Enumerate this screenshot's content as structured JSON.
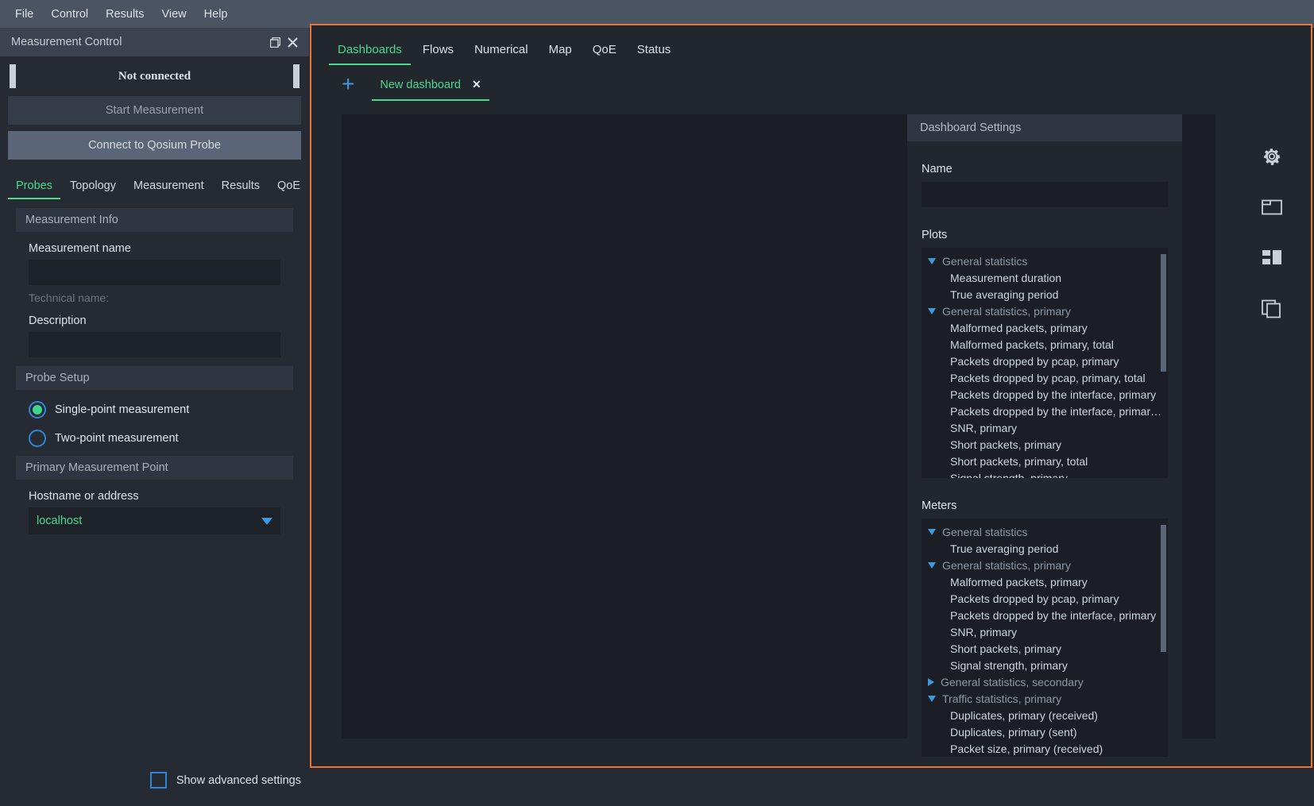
{
  "menubar": {
    "items": [
      "File",
      "Control",
      "Results",
      "View",
      "Help"
    ]
  },
  "left_panel": {
    "title": "Measurement Control",
    "status": "Not connected",
    "start_button": "Start Measurement",
    "connect_button": "Connect to Qosium Probe",
    "tabs": [
      {
        "label": "Probes",
        "active": true
      },
      {
        "label": "Topology",
        "active": false
      },
      {
        "label": "Measurement",
        "active": false
      },
      {
        "label": "Results",
        "active": false
      },
      {
        "label": "QoE",
        "active": false
      }
    ],
    "measurement_info": {
      "header": "Measurement Info",
      "name_label": "Measurement name",
      "name_value": "",
      "technical_name": "Technical name:",
      "description_label": "Description",
      "description_value": ""
    },
    "probe_setup": {
      "header": "Probe Setup",
      "options": [
        {
          "label": "Single-point measurement",
          "selected": true
        },
        {
          "label": "Two-point measurement",
          "selected": false
        }
      ]
    },
    "primary_measurement_point": {
      "header": "Primary Measurement Point",
      "hostname_label": "Hostname or address",
      "hostname_value": "localhost"
    },
    "advanced": {
      "label": "Show advanced settings",
      "checked": false
    }
  },
  "main": {
    "tabs": [
      {
        "label": "Dashboards",
        "active": true
      },
      {
        "label": "Flows",
        "active": false
      },
      {
        "label": "Numerical",
        "active": false
      },
      {
        "label": "Map",
        "active": false
      },
      {
        "label": "QoE",
        "active": false
      },
      {
        "label": "Status",
        "active": false
      }
    ],
    "add_tab_glyph": "+",
    "dashboard_tabs": [
      {
        "label": "New dashboard",
        "close": "✕",
        "active": true
      }
    ]
  },
  "dashboard_settings": {
    "header": "Dashboard Settings",
    "name_label": "Name",
    "name_value": "",
    "plots_label": "Plots",
    "plots_tree": [
      {
        "type": "group",
        "label": "General statistics",
        "expanded": true
      },
      {
        "type": "leaf",
        "label": "Measurement duration"
      },
      {
        "type": "leaf",
        "label": "True averaging period"
      },
      {
        "type": "group",
        "label": "General statistics, primary",
        "expanded": true
      },
      {
        "type": "leaf",
        "label": "Malformed packets, primary"
      },
      {
        "type": "leaf",
        "label": "Malformed packets, primary, total"
      },
      {
        "type": "leaf",
        "label": "Packets dropped by pcap, primary"
      },
      {
        "type": "leaf",
        "label": "Packets dropped by pcap, primary, total"
      },
      {
        "type": "leaf",
        "label": "Packets dropped by the interface, primary"
      },
      {
        "type": "leaf",
        "label": "Packets dropped by the interface, primar…"
      },
      {
        "type": "leaf",
        "label": "SNR, primary"
      },
      {
        "type": "leaf",
        "label": "Short packets, primary"
      },
      {
        "type": "leaf",
        "label": "Short packets, primary, total"
      },
      {
        "type": "leaf",
        "label": "Signal strength, primary"
      }
    ],
    "meters_label": "Meters",
    "meters_tree": [
      {
        "type": "group",
        "label": "General statistics",
        "expanded": true
      },
      {
        "type": "leaf",
        "label": "True averaging period"
      },
      {
        "type": "group",
        "label": "General statistics, primary",
        "expanded": true
      },
      {
        "type": "leaf",
        "label": "Malformed packets, primary"
      },
      {
        "type": "leaf",
        "label": "Packets dropped by pcap, primary"
      },
      {
        "type": "leaf",
        "label": "Packets dropped by the interface, primary"
      },
      {
        "type": "leaf",
        "label": "SNR, primary"
      },
      {
        "type": "leaf",
        "label": "Short packets, primary"
      },
      {
        "type": "leaf",
        "label": "Signal strength, primary"
      },
      {
        "type": "group",
        "label": "General statistics, secondary",
        "expanded": false
      },
      {
        "type": "group",
        "label": "Traffic statistics, primary",
        "expanded": true
      },
      {
        "type": "leaf",
        "label": "Duplicates, primary (received)"
      },
      {
        "type": "leaf",
        "label": "Duplicates, primary (sent)"
      },
      {
        "type": "leaf",
        "label": "Packet size, primary (received)"
      }
    ]
  },
  "rail": {
    "icons": [
      "gear-icon",
      "panel-window-icon",
      "dashboard-layout-icon",
      "duplicate-window-icon"
    ]
  },
  "colors": {
    "accent_green": "#4ad98f",
    "accent_blue": "#3e9ae0",
    "focus_orange": "#e8743a",
    "panel_bg": "#262b33",
    "menu_bg": "#4a5462"
  }
}
